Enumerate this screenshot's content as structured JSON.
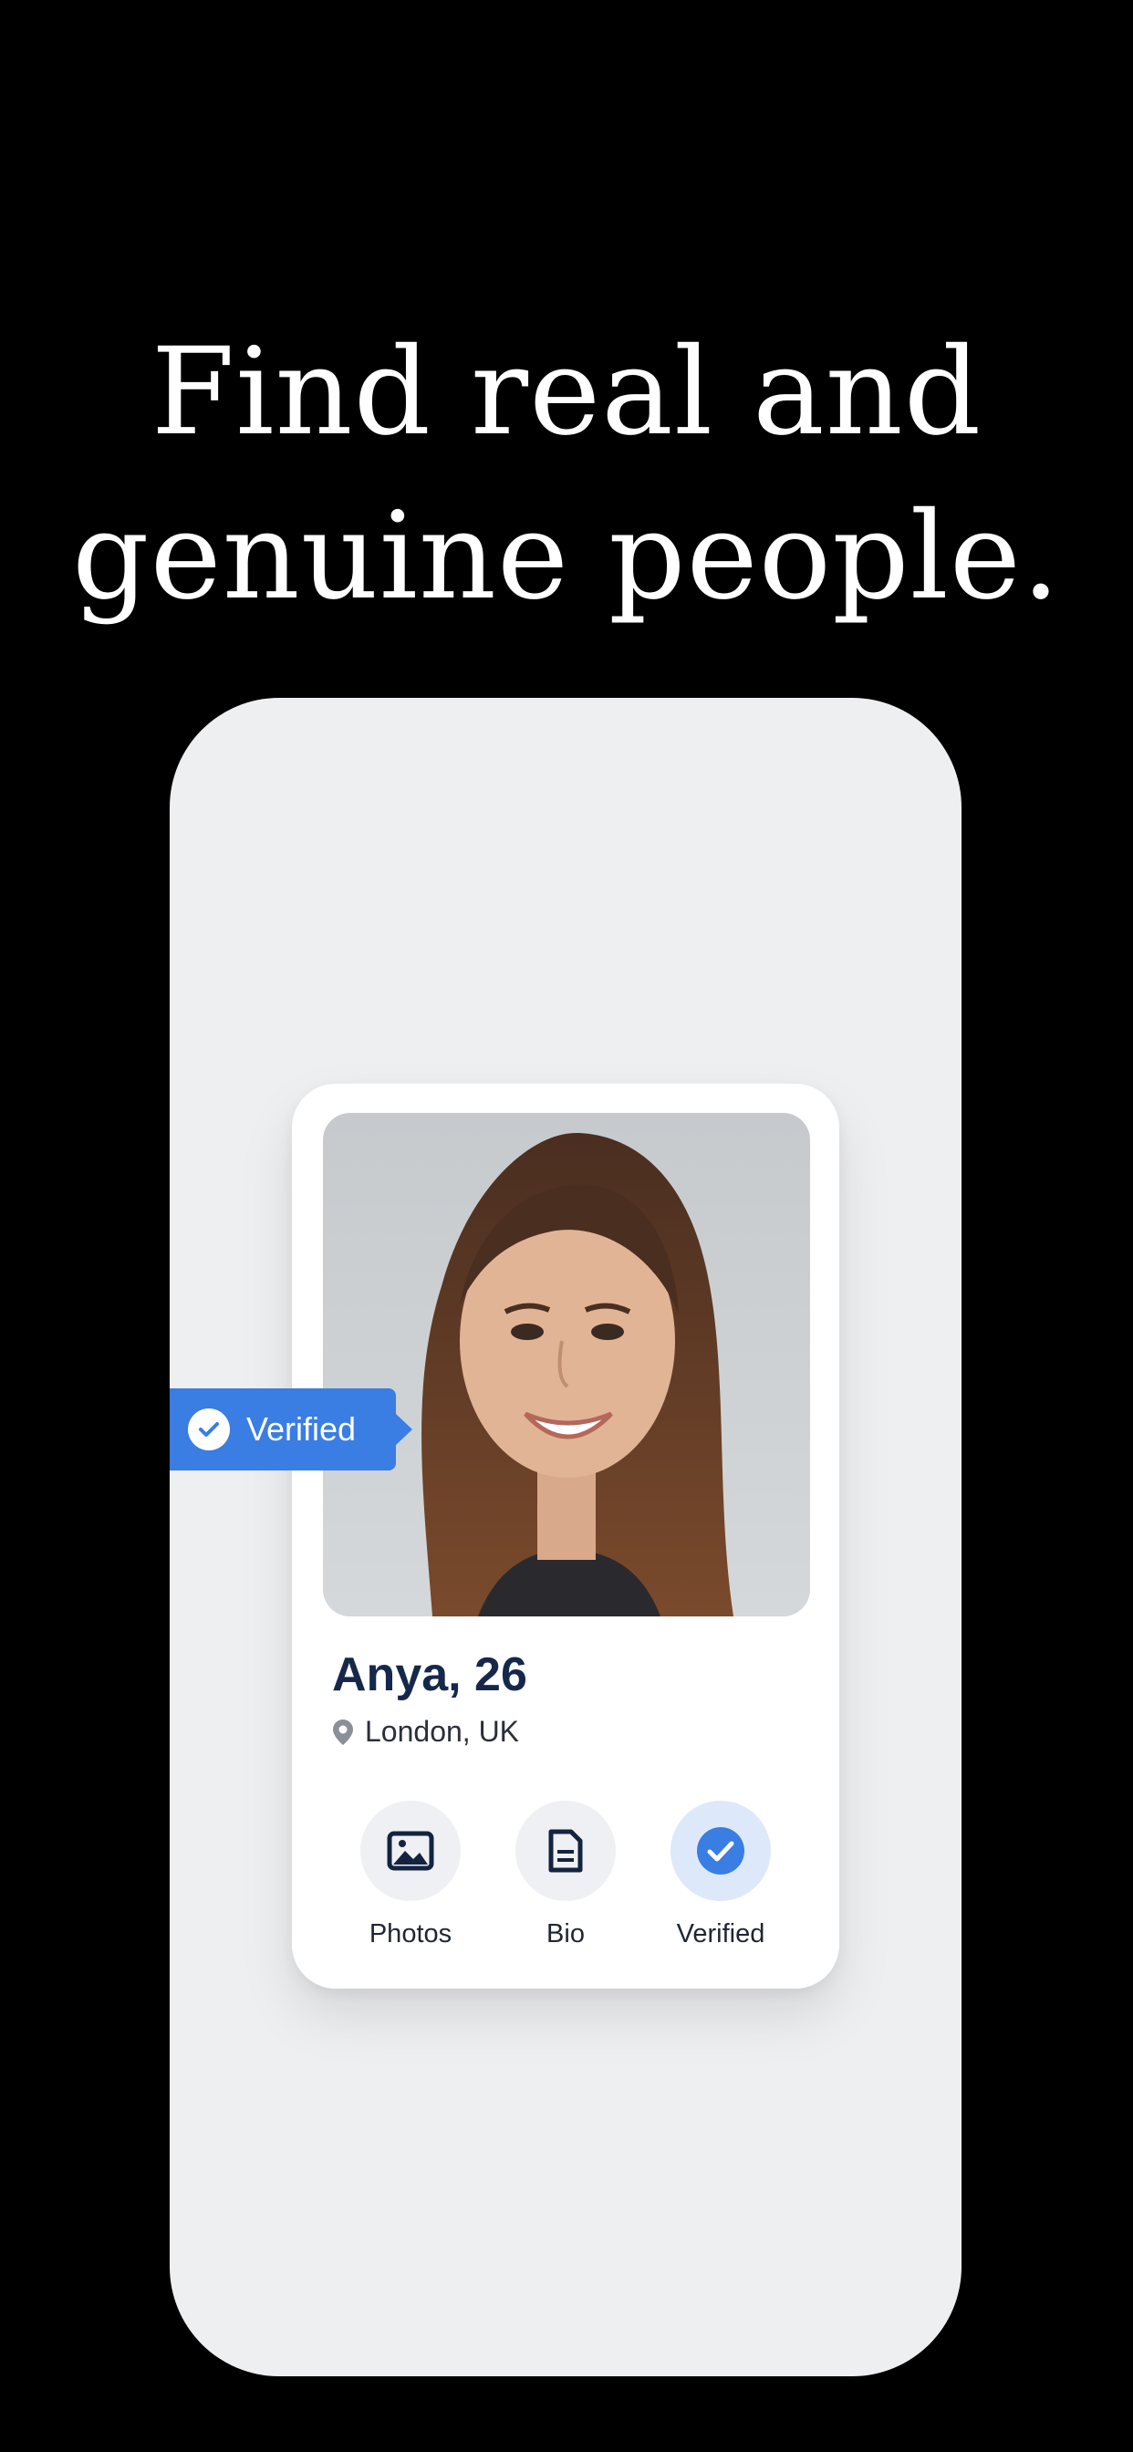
{
  "headline": {
    "line1": "Find real and",
    "line2": "genuine people."
  },
  "profile": {
    "name_age": "Anya, 26",
    "location": "London, UK",
    "verified_tag": "Verified",
    "actions": [
      {
        "label": "Photos",
        "icon": "image-icon"
      },
      {
        "label": "Bio",
        "icon": "document-icon"
      },
      {
        "label": "Verified",
        "icon": "check-circle-icon"
      }
    ]
  },
  "colors": {
    "background": "#000000",
    "phone": "#eeeff1",
    "accent": "#3a7de3",
    "name": "#16284a"
  }
}
